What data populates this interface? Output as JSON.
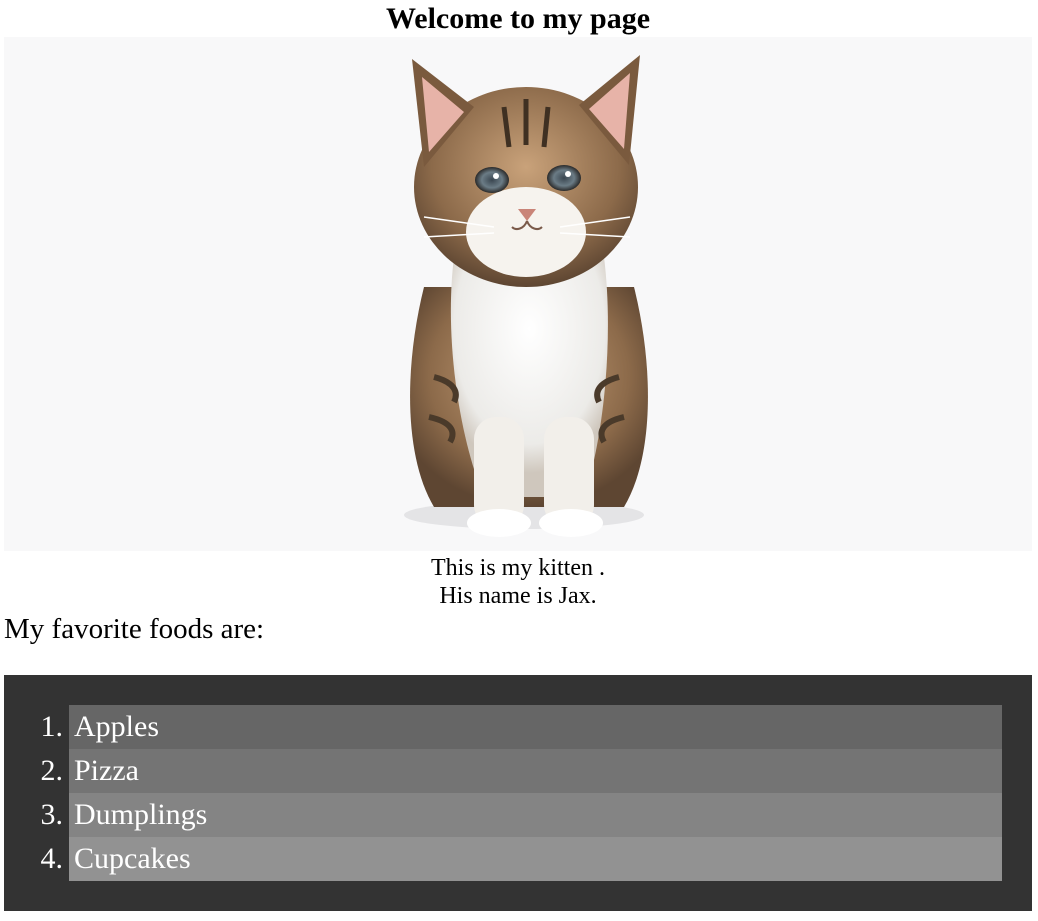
{
  "page": {
    "title": "Welcome to my page"
  },
  "photo": {
    "subject": "kitten-photo",
    "background": "#f8f8f9"
  },
  "caption": {
    "line1": "This is my kitten .",
    "line2": "His name is Jax."
  },
  "foods": {
    "intro": "My favorite foods are:",
    "items": [
      {
        "number": "1.",
        "label": "Apples"
      },
      {
        "number": "2.",
        "label": "Pizza"
      },
      {
        "number": "3.",
        "label": "Dumplings"
      },
      {
        "number": "4.",
        "label": "Cupcakes"
      }
    ],
    "panel_color": "#333333",
    "row_colors": [
      "#666666",
      "#747474",
      "#848484",
      "#929292"
    ],
    "text_color": "#ffffff"
  }
}
